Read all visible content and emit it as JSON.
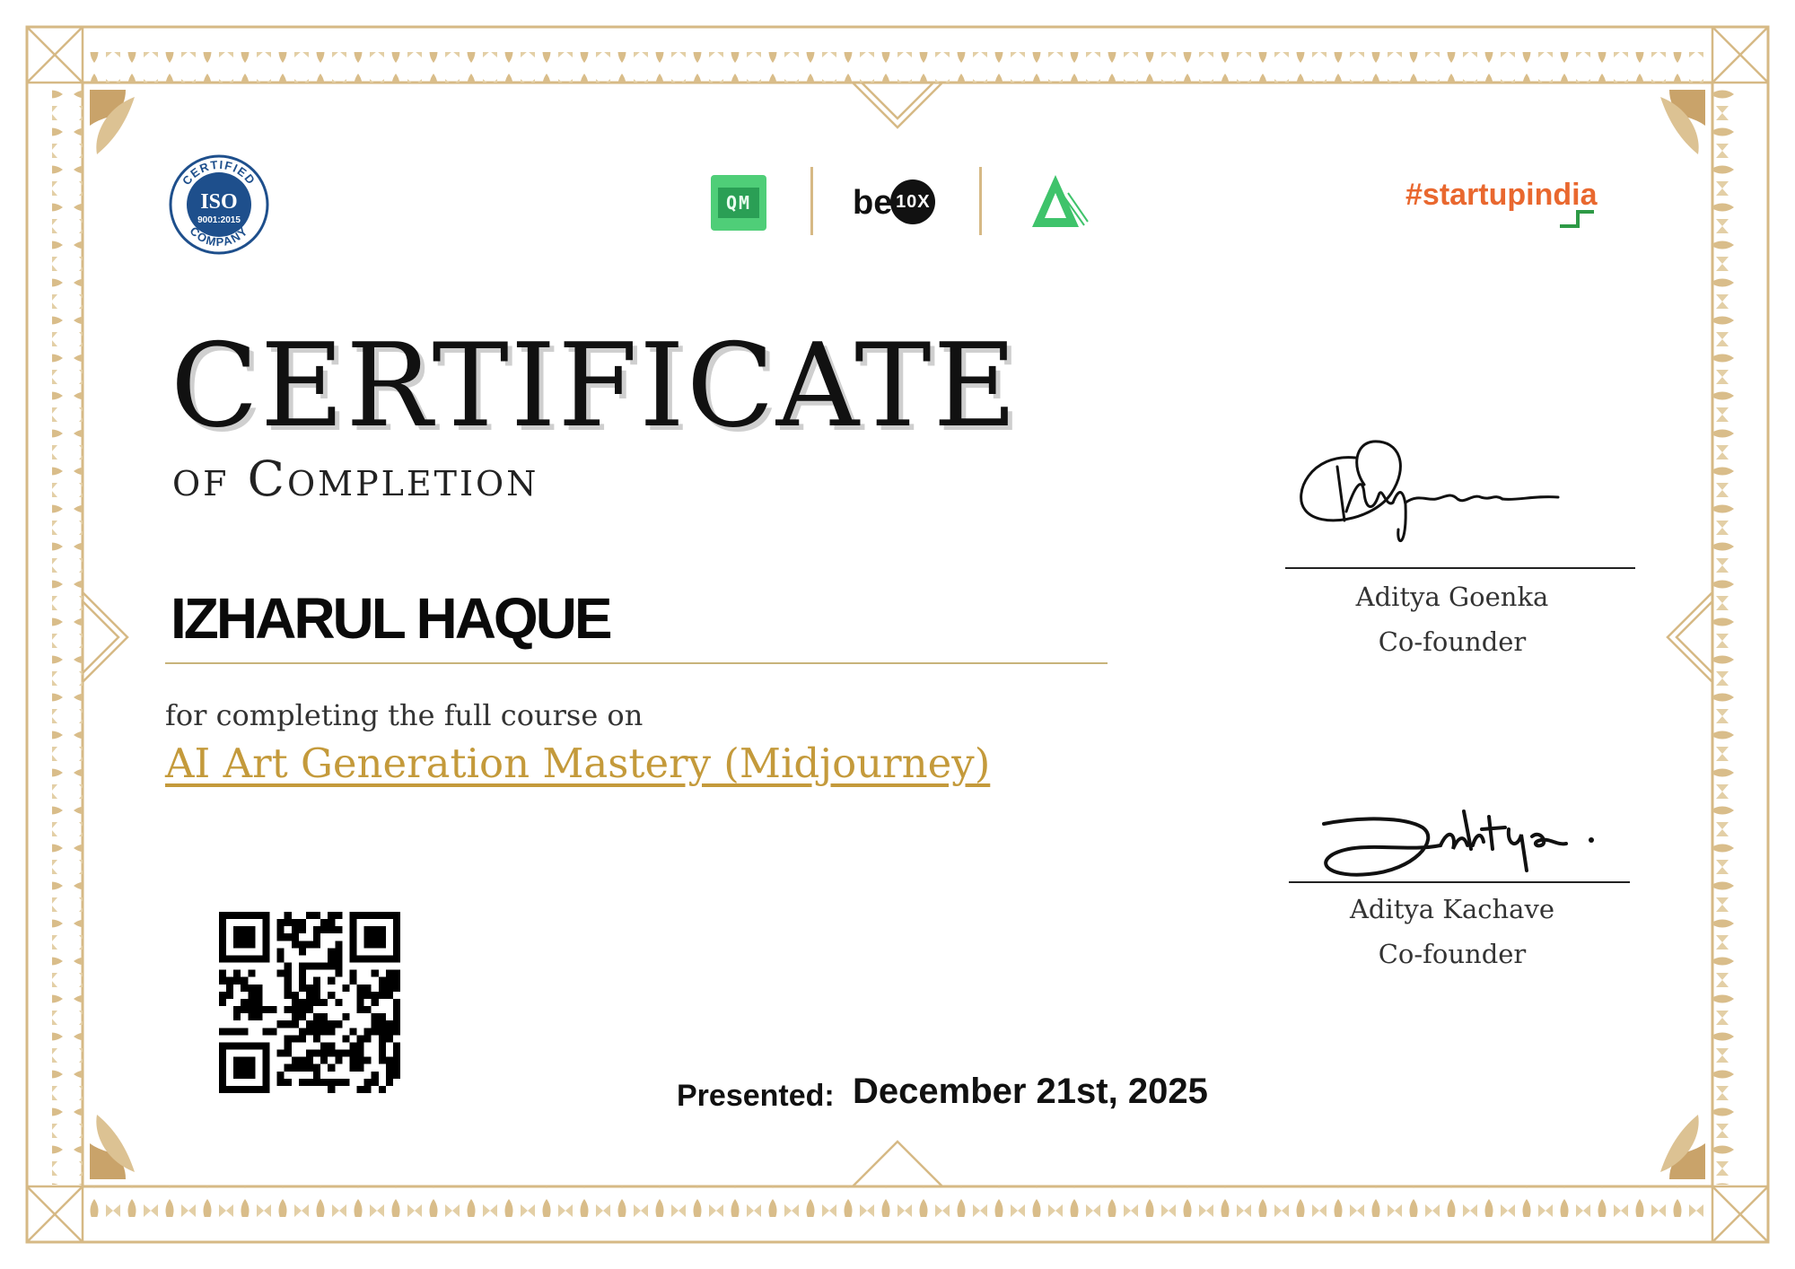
{
  "logos": {
    "iso": {
      "top_text": "CERTIFIED",
      "main": "ISO",
      "standard": "9001:2015",
      "bottom_text": "COMPANY"
    },
    "qm": "QM",
    "be10x": {
      "prefix": "be",
      "badge": "10X"
    },
    "startupindia": "#startupindia"
  },
  "certificate": {
    "title": "CERTIFICATE",
    "subtitle": "of Completion",
    "recipient": "IZHARUL HAQUE",
    "description": "for completing the full course on",
    "course": "AI Art Generation Mastery (Midjourney)",
    "presented_label": "Presented:",
    "date": "December 21st, 2025"
  },
  "signatories": [
    {
      "name": "Aditya Goenka",
      "role": "Co-founder"
    },
    {
      "name": "Aditya Kachave",
      "role": "Co-founder"
    }
  ],
  "colors": {
    "gold": "#c49a3b",
    "border": "#d6b985",
    "startup": "#e9682f",
    "qm_green": "#4fce78"
  }
}
